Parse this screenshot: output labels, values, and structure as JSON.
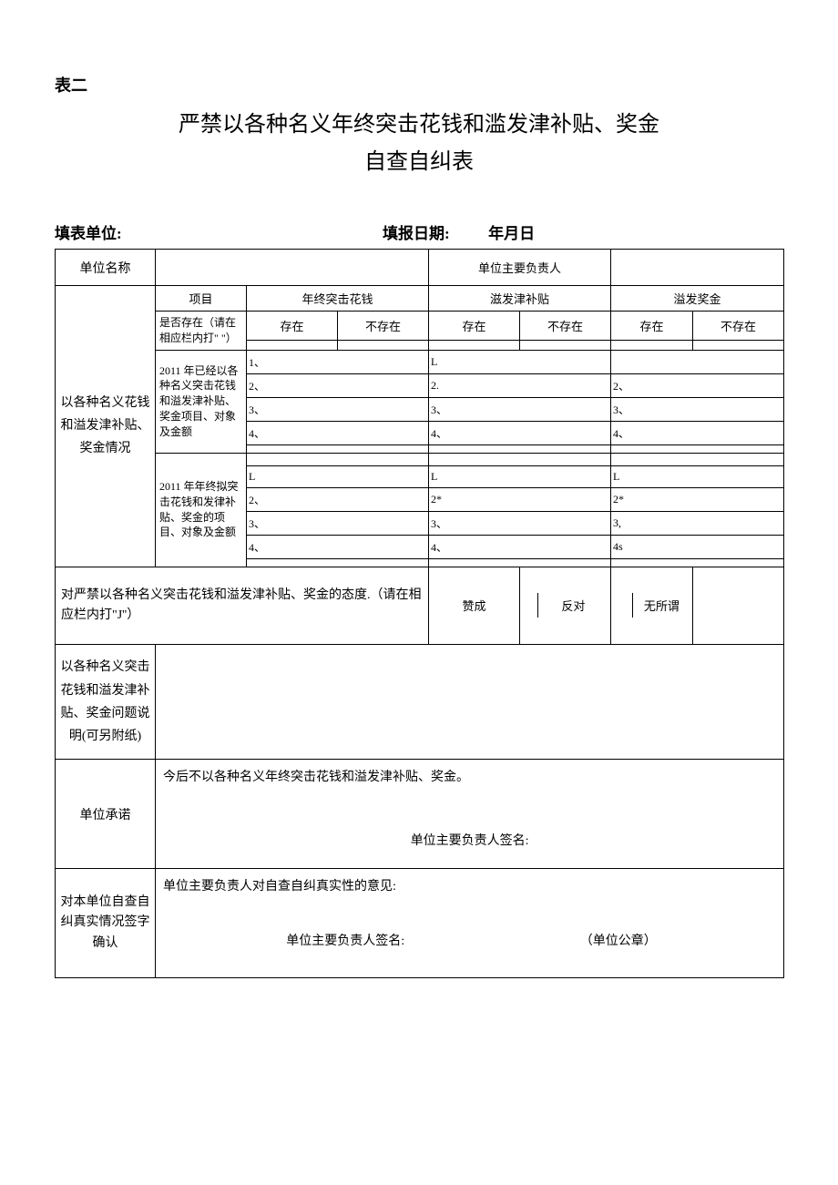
{
  "header_label": "表二",
  "title_line1": "严禁以各种名义年终突击花钱和滥发津补贴、奖金",
  "title_line2": "自查自纠表",
  "meta": {
    "unit_label": "填表单位:",
    "date_label": "填报日期:",
    "date_value": "年月日"
  },
  "row1": {
    "unit_name_label": "单位名称",
    "principal_label": "单位主要负责人"
  },
  "block": {
    "main_label": "以各种名义花钱和溢发津补贴、奖金情况",
    "project_label": "项目",
    "col1": "年终突击花钱",
    "col2": "滋发津补贴",
    "col3": "溢发奖金",
    "exists_row_label": "是否存在（请在相应栏内打\" \"）",
    "exist": "存在",
    "not_exist": "不存在",
    "group1_label": "2011 年已经以各种名义突击花钱和溢发津补贴、奖金项目、对象及金额",
    "group2_label": "2011 年年终拟突击花钱和发律补贴、奖金的项目、对象及金额",
    "g1": {
      "c1": [
        "1、",
        "2、",
        "3、",
        "4、",
        ""
      ],
      "c2": [
        "L",
        "2.",
        "3、",
        "4、",
        ""
      ],
      "c3": [
        "",
        "2、",
        "3、",
        "4、",
        ""
      ]
    },
    "g2": {
      "c1": [
        "L",
        "2、",
        "3、",
        "4、",
        ""
      ],
      "c2": [
        "L",
        "2*",
        "3、",
        "4、",
        ""
      ],
      "c3": [
        "L",
        "2*",
        "3,",
        "4s",
        ""
      ]
    }
  },
  "attitude": {
    "label": "对严禁以各种名义突击花钱和溢发津补贴、奖金的态度.（请在相应栏内打\"J''）",
    "opt1": "赞成",
    "opt2": "反对",
    "opt3": "无所谓"
  },
  "explain_label": "以各种名义突击花钱和溢发津补贴、奖金问题说明(可另附纸)",
  "commitment": {
    "label": "单位承诺",
    "text": "今后不以各种名义年终突击花钱和溢发津补贴、奖金。",
    "sign": "单位主要负责人签名:"
  },
  "confirm": {
    "label": "对本单位自查自纠真实情况签字确认",
    "text": "单位主要负责人对自查自纠真实性的意见:",
    "sign": "单位主要负责人签名:",
    "seal": "（单位公章）"
  }
}
